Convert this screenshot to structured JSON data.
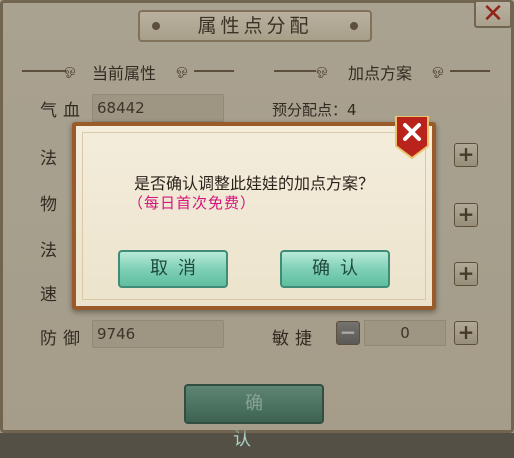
{
  "window": {
    "title": "属性点分配",
    "close_icon": "close-icon"
  },
  "left_section": {
    "title": "当前属性",
    "rows": [
      {
        "label": "气血",
        "value": "68442"
      },
      {
        "label": "法",
        "value": ""
      },
      {
        "label": "物",
        "value": ""
      },
      {
        "label": "法",
        "value": ""
      },
      {
        "label": "速",
        "value": ""
      },
      {
        "label": "防御",
        "value": "9746"
      }
    ]
  },
  "right_section": {
    "title": "加点方案",
    "pre_points": "预分配点：4",
    "last_stat": {
      "label": "敏捷",
      "value": "0"
    }
  },
  "confirm_button": "确 认",
  "dialog": {
    "message": "是否确认调整此娃娃的加点方案？",
    "note": "（每日首次免费）",
    "cancel_label": "取消",
    "confirm_label": "确认"
  },
  "colors": {
    "accent_green": "#7fd0b6",
    "dialog_border": "#9b5a2a",
    "note_pink": "#d4157b",
    "close_red": "#b51d14"
  }
}
